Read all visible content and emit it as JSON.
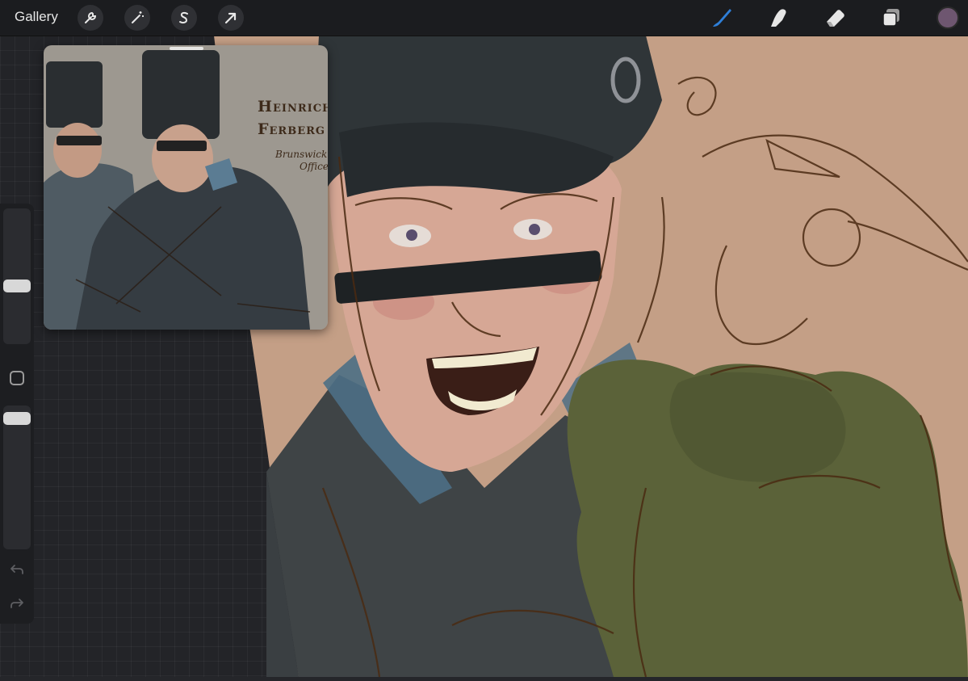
{
  "topbar": {
    "gallery_label": "Gallery",
    "left_tools": [
      {
        "name": "actions",
        "icon": "wrench-icon"
      },
      {
        "name": "adjustments",
        "icon": "magic-wand-icon"
      },
      {
        "name": "selection",
        "icon": "selection-s-icon"
      },
      {
        "name": "transform",
        "icon": "arrow-cursor-icon"
      }
    ],
    "right_tools": [
      {
        "name": "brush",
        "icon": "brush-icon",
        "active": true
      },
      {
        "name": "smudge",
        "icon": "smudge-finger-icon"
      },
      {
        "name": "eraser",
        "icon": "eraser-icon"
      },
      {
        "name": "layers",
        "icon": "layers-icon"
      }
    ],
    "current_color": "#6e5670",
    "active_tool_color": "#2f7fd8"
  },
  "reference": {
    "title_line1": "Heinrich",
    "title_line2": "Ferberg",
    "subtitle_line1": "Brunswick",
    "subtitle_line2": "Officer"
  },
  "sidebar": {
    "brush_size_level": 0.55,
    "opacity_level": 1.0,
    "modify_icon": "square-modify-icon",
    "undo_icon": "undo-arrow-icon",
    "redo_icon": "redo-arrow-icon"
  },
  "canvas": {
    "background_color": "#c49f86",
    "skin_color": "#d6a795",
    "coat_color": "#3f4446",
    "hat_color": "#2f3538",
    "fur_color": "#5b6239",
    "line_color": "#4a2a12",
    "collar_color": "#4d6f85"
  }
}
